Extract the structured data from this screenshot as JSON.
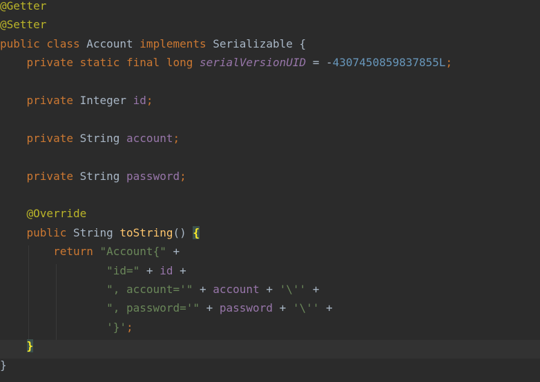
{
  "editor": {
    "lines": [
      [
        {
          "t": "@Getter",
          "c": "ann"
        }
      ],
      [
        {
          "t": "@Setter",
          "c": "ann"
        }
      ],
      [
        {
          "t": "public class ",
          "c": "kw"
        },
        {
          "t": "Account ",
          "c": "def"
        },
        {
          "t": "implements ",
          "c": "kw"
        },
        {
          "t": "Serializable {",
          "c": "def"
        }
      ],
      [
        {
          "t": "    private static final long ",
          "c": "kw"
        },
        {
          "t": "serialVersionUID",
          "c": "sfl"
        },
        {
          "t": " = -",
          "c": "def"
        },
        {
          "t": "4307450859837855L",
          "c": "num"
        },
        {
          "t": ";",
          "c": "kw"
        }
      ],
      [],
      [
        {
          "t": "    private ",
          "c": "kw"
        },
        {
          "t": "Integer ",
          "c": "def"
        },
        {
          "t": "id",
          "c": "fld"
        },
        {
          "t": ";",
          "c": "kw"
        }
      ],
      [],
      [
        {
          "t": "    private ",
          "c": "kw"
        },
        {
          "t": "String ",
          "c": "def"
        },
        {
          "t": "account",
          "c": "fld"
        },
        {
          "t": ";",
          "c": "kw"
        }
      ],
      [],
      [
        {
          "t": "    private ",
          "c": "kw"
        },
        {
          "t": "String ",
          "c": "def"
        },
        {
          "t": "password",
          "c": "fld"
        },
        {
          "t": ";",
          "c": "kw"
        }
      ],
      [],
      [
        {
          "t": "    @Override",
          "c": "ann"
        }
      ],
      [
        {
          "t": "    public ",
          "c": "kw"
        },
        {
          "t": "String ",
          "c": "def"
        },
        {
          "t": "toString",
          "c": "mth"
        },
        {
          "t": "() ",
          "c": "def"
        },
        {
          "t": "{",
          "c": "brace-hl"
        }
      ],
      [
        {
          "t": "        return ",
          "c": "kw"
        },
        {
          "t": "\"Account{\"",
          "c": "str"
        },
        {
          "t": " +",
          "c": "def"
        }
      ],
      [
        {
          "t": "                ",
          "c": "def"
        },
        {
          "t": "\"id=\"",
          "c": "str"
        },
        {
          "t": " + ",
          "c": "def"
        },
        {
          "t": "id",
          "c": "fld"
        },
        {
          "t": " +",
          "c": "def"
        }
      ],
      [
        {
          "t": "                ",
          "c": "def"
        },
        {
          "t": "\", account='\"",
          "c": "str"
        },
        {
          "t": " + ",
          "c": "def"
        },
        {
          "t": "account",
          "c": "fld"
        },
        {
          "t": " + ",
          "c": "def"
        },
        {
          "t": "'\\''",
          "c": "str"
        },
        {
          "t": " +",
          "c": "def"
        }
      ],
      [
        {
          "t": "                ",
          "c": "def"
        },
        {
          "t": "\", password='\"",
          "c": "str"
        },
        {
          "t": " + ",
          "c": "def"
        },
        {
          "t": "password",
          "c": "fld"
        },
        {
          "t": " + ",
          "c": "def"
        },
        {
          "t": "'\\''",
          "c": "str"
        },
        {
          "t": " +",
          "c": "def"
        }
      ],
      [
        {
          "t": "                ",
          "c": "def"
        },
        {
          "t": "'}'",
          "c": "str"
        },
        {
          "t": ";",
          "c": "kw"
        }
      ],
      [
        {
          "t": "    ",
          "c": "def"
        },
        {
          "t": "}",
          "c": "brace-hl"
        }
      ],
      [
        {
          "t": "}",
          "c": "def"
        }
      ]
    ],
    "current_line": 18,
    "colors": {
      "background": "#2b2b2b",
      "current_line": "#323232",
      "keyword": "#cc7832",
      "annotation": "#bbb529",
      "field": "#9876aa",
      "number": "#6897bb",
      "string": "#6a8759",
      "method": "#ffc66d",
      "default": "#a9b7c6",
      "brace_match": "#ffef28"
    }
  }
}
